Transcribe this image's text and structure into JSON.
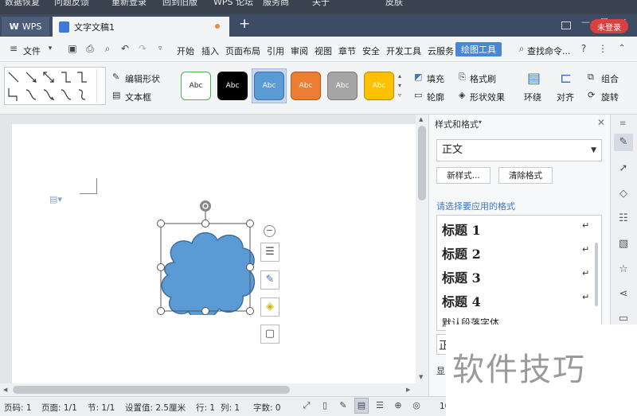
{
  "topband": {
    "fragments": [
      "数据恢复",
      "问题反馈",
      "重新登录",
      "回到旧版",
      "WPS 论坛",
      "服务商",
      "关于",
      "皮肤"
    ]
  },
  "tabs": {
    "wps_label": "WPS",
    "doc_label": "文字文稿1",
    "new_tab": "+",
    "login": "未登录"
  },
  "menu": {
    "file": "文件",
    "items": [
      "开始",
      "插入",
      "页面布局",
      "引用",
      "审阅",
      "视图",
      "章节",
      "安全",
      "开发工具",
      "云服务"
    ],
    "active": "绘图工具",
    "search": "查找命令...",
    "help": "?"
  },
  "ribbon": {
    "edit_shape": "编辑形状",
    "text_box": "文本框",
    "style_buttons": [
      {
        "label": "Abc",
        "bg": "#ffffff",
        "fg": "#222222",
        "border": "#4caf50"
      },
      {
        "label": "Abc",
        "bg": "#000000",
        "fg": "#ffffff",
        "border": "#000000"
      },
      {
        "label": "Abc",
        "bg": "#5b9bd5",
        "fg": "#ffffff",
        "border": "#41719c"
      },
      {
        "label": "Abc",
        "bg": "#ed7d31",
        "fg": "#ffffff",
        "border": "#ae5a21"
      },
      {
        "label": "Abc",
        "bg": "#a5a5a5",
        "fg": "#ffffff",
        "border": "#787878"
      },
      {
        "label": "Abc",
        "bg": "#ffc000",
        "fg": "#ffffff",
        "border": "#bc8c00"
      }
    ],
    "fill": "填充",
    "format_painter": "格式刷",
    "outline": "轮廓",
    "shape_effects": "形状效果",
    "wrap": "环绕",
    "align": "对齐",
    "group": "组合",
    "rotate": "旋转"
  },
  "panel": {
    "title": "样式和格式",
    "current_style": "正文",
    "new_style": "新样式...",
    "clear_format": "清除格式",
    "apply_label": "请选择要应用的格式",
    "headings": [
      "标题 1",
      "标题 2",
      "标题 3",
      "标题 4"
    ],
    "partial_row": "默认段落字体",
    "return_mark": "↵"
  },
  "status": {
    "page_num": "页码: 1",
    "pages": "页面: 1/1",
    "section": "节: 1/1",
    "setting": "设置值: 2.5厘米",
    "row": "行: 1",
    "col": "列: 1",
    "words": "字数: 0",
    "zoom_frag": "10"
  },
  "watermark": "软件技巧",
  "fragments": {
    "list_frag": "正",
    "show_frag": "显"
  },
  "colors": {
    "shape_fill": "#5b9bd5",
    "shape_stroke": "#41719c",
    "accent": "#4a86d8",
    "login": "#d94040"
  }
}
